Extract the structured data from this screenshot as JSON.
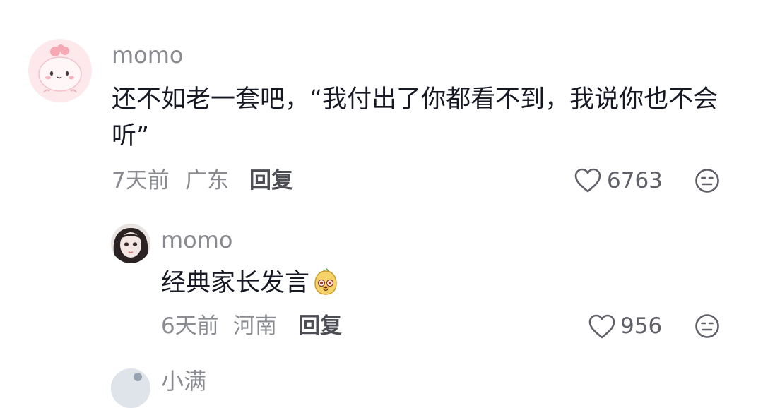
{
  "comments": [
    {
      "username": "momo",
      "text": "还不如老一套吧，“我付出了你都看不到，我说你也不会听”",
      "time": "7天前",
      "location": "广东",
      "reply_label": "回复",
      "likes": "6763",
      "avatar_icon": "pink-cartoon-avatar",
      "dislike_icon": "neutral-face-icon"
    }
  ],
  "replies": [
    {
      "username": "momo",
      "text": "经典家长发言",
      "emoji": "dog-face-emoji",
      "time": "6天前",
      "location": "河南",
      "reply_label": "回复",
      "likes": "956",
      "avatar_icon": "girl-portrait-avatar",
      "dislike_icon": "neutral-face-icon"
    }
  ],
  "next_comment": {
    "username": "小满",
    "avatar_icon": "partial-avatar"
  },
  "colors": {
    "secondary_text": "#8a8b91",
    "primary_text": "#161823",
    "reply_text": "#4d4e55",
    "avatar_pink": "#fde7ea"
  }
}
